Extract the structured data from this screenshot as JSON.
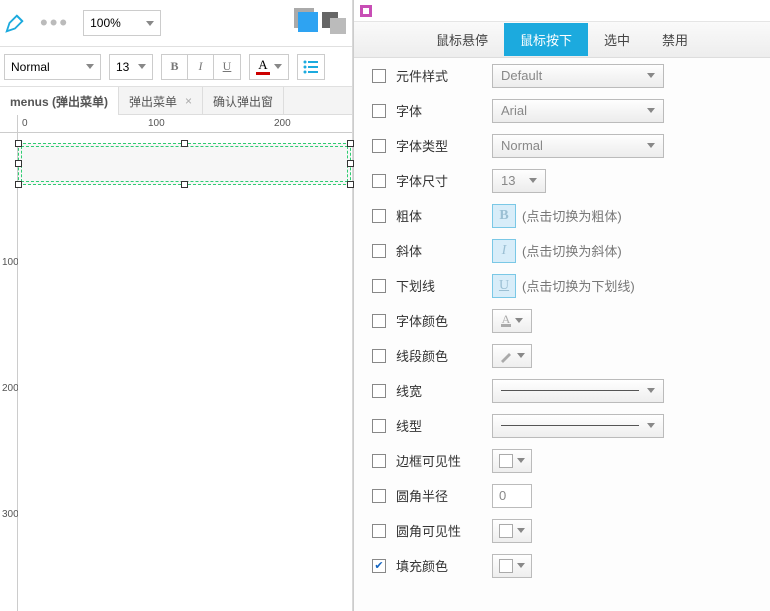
{
  "toolbar": {
    "zoom": "100%",
    "font_weight": "Normal",
    "font_size": "13",
    "bold_glyph": "B",
    "italic_glyph": "I",
    "underline_glyph": "U",
    "colorA_glyph": "A"
  },
  "tabs": [
    {
      "label": "menus (弹出菜单)",
      "active": true
    },
    {
      "label": "弹出菜单",
      "active": false
    },
    {
      "label": "确认弹出窗",
      "active": false
    }
  ],
  "ruler_h": [
    "0",
    "100",
    "200"
  ],
  "ruler_v": [
    "100",
    "200",
    "300"
  ],
  "state_tabs": {
    "hover": "鼠标悬停",
    "pressed": "鼠标按下",
    "selected": "选中",
    "disabled": "禁用"
  },
  "props": {
    "style": {
      "label": "元件样式",
      "value": "Default"
    },
    "font": {
      "label": "字体",
      "value": "Arial"
    },
    "font_type": {
      "label": "字体类型",
      "value": "Normal"
    },
    "font_size": {
      "label": "字体尺寸",
      "value": "13"
    },
    "bold": {
      "label": "粗体",
      "hint": "(点击切换为粗体)",
      "glyph": "B"
    },
    "italic": {
      "label": "斜体",
      "hint": "(点击切换为斜体)",
      "glyph": "I"
    },
    "underline": {
      "label": "下划线",
      "hint": "(点击切换为下划线)",
      "glyph": "U"
    },
    "font_color": {
      "label": "字体颜色"
    },
    "line_color": {
      "label": "线段颜色"
    },
    "line_width": {
      "label": "线宽"
    },
    "line_style": {
      "label": "线型"
    },
    "border_vis": {
      "label": "边框可见性"
    },
    "corner_radius": {
      "label": "圆角半径",
      "value": "0"
    },
    "corner_vis": {
      "label": "圆角可见性"
    },
    "fill_color": {
      "label": "填充颜色"
    }
  }
}
